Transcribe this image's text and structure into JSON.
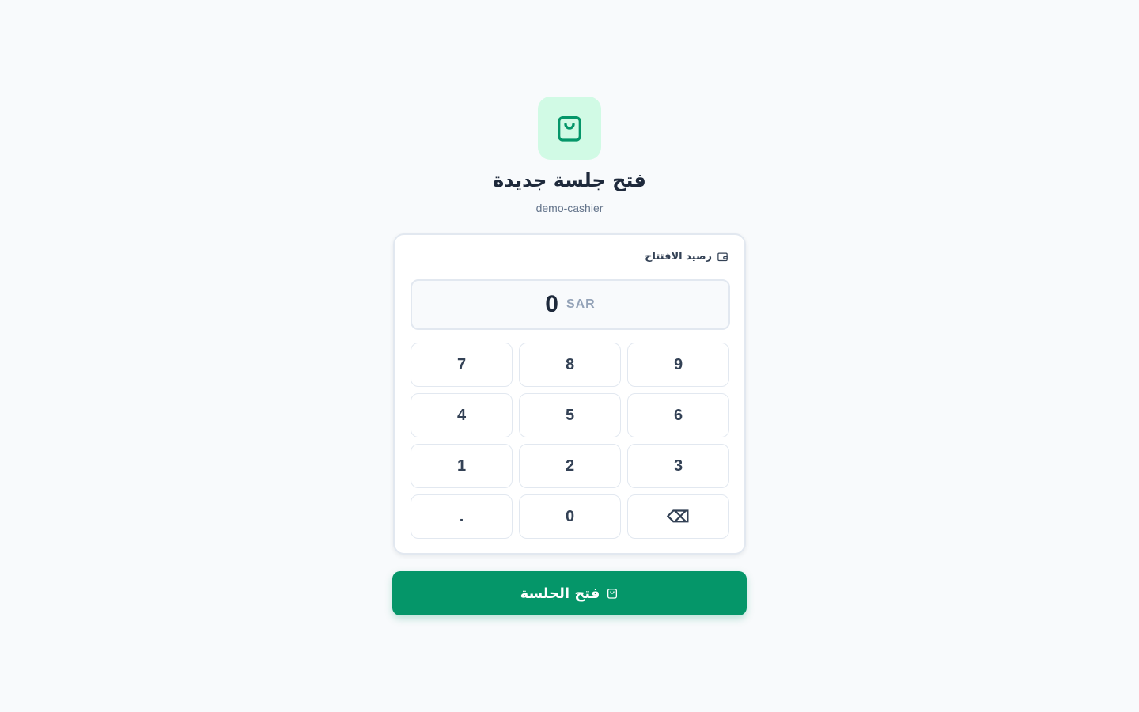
{
  "header": {
    "logo_icon": "shopping-bag-icon",
    "title": "فتح جلسة جديدة",
    "subtitle": "demo-cashier"
  },
  "form": {
    "field_label": "رصيد الافتتاح",
    "field_icon": "wallet-icon",
    "amount_value": "0",
    "currency": "SAR"
  },
  "keypad": {
    "keys": [
      "7",
      "8",
      "9",
      "4",
      "5",
      "6",
      "1",
      "2",
      "3",
      ".",
      "0",
      "⌫"
    ]
  },
  "submit": {
    "label": "فتح الجلسة",
    "icon": "shopping-bag-icon"
  },
  "colors": {
    "accent": "#059669",
    "accent_light": "#d1fae5",
    "text_dark": "#1e293b",
    "text_muted": "#64748b"
  }
}
